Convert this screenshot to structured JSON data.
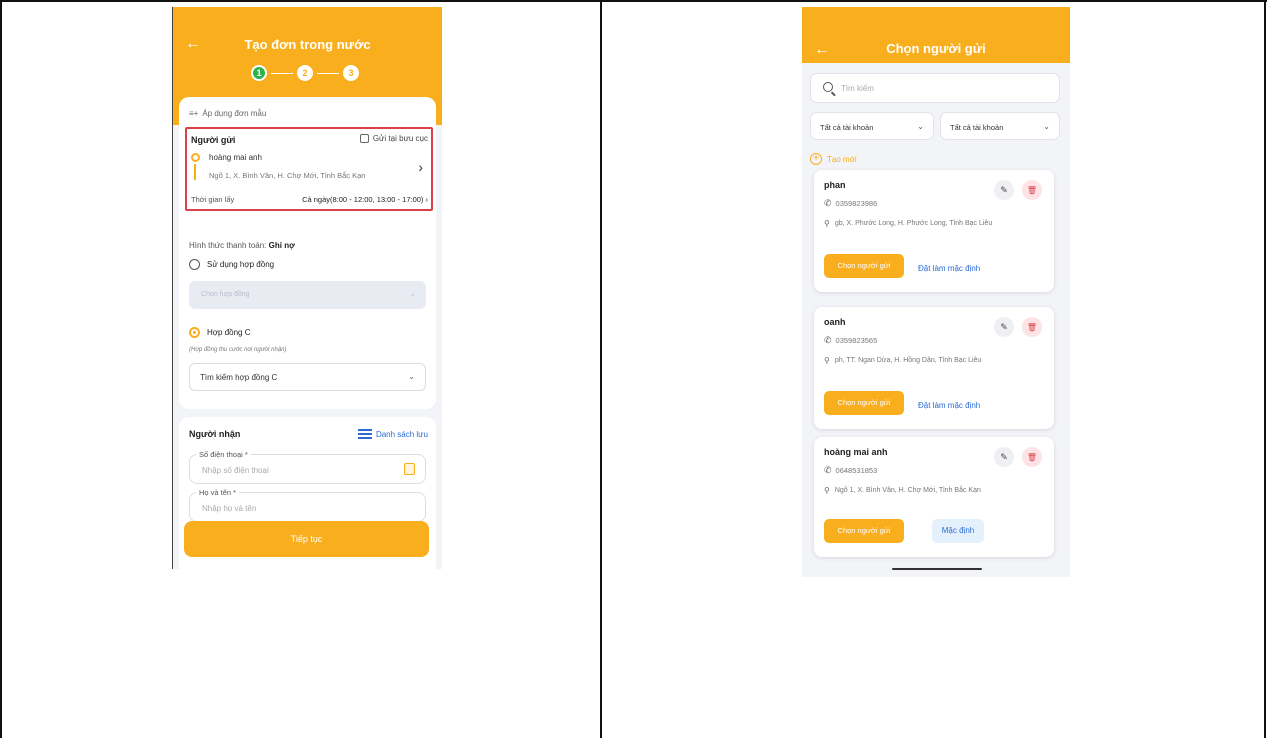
{
  "left_screen": {
    "header": {
      "title": "Tạo đơn trong nước",
      "steps": [
        "1",
        "2",
        "3"
      ]
    },
    "apply_template": "Áp dụng đơn mẫu",
    "sender": {
      "label": "Người gửi",
      "post_office_checkbox": "Gửi tại bưu cục",
      "name": "hoàng mai anh",
      "address": "Ngõ 1, X. Bình Văn, H. Chợ Mới, Tỉnh Bắc Kạn",
      "pickup_label": "Thời gian lấy",
      "pickup_value": "Cả ngày(8:00 - 12:00, 13:00 - 17:00) ›"
    },
    "payment": {
      "label": "Hình thức thanh toán:",
      "value": "Ghi nợ"
    },
    "option_contract": "Sử dụng hợp đồng",
    "contract_select_placeholder": "Chọn hợp đồng",
    "option_contract_c": "Hợp đồng C",
    "contract_c_note": "(Hợp đồng thu cước nơi người nhận)",
    "search_contract_c": "Tìm kiếm hợp đồng C",
    "receiver": {
      "label": "Người nhận",
      "saved_list": "Danh sách lưu",
      "phone_label": "Số điện thoại *",
      "phone_placeholder": "Nhập số điện thoại",
      "name_label": "Họ và tên *",
      "name_placeholder": "Nhập họ và tên"
    },
    "continue_button": "Tiếp tục"
  },
  "right_screen": {
    "header": {
      "title": "Chọn người gửi"
    },
    "search_placeholder": "Tìm kiếm",
    "filter1": "Tất cả tài khoản",
    "filter2": "Tất cả tài khoản",
    "create_new": "Tạo mới",
    "choose_label": "Chọn người gửi",
    "set_default_label": "Đặt làm mặc định",
    "default_badge": "Mặc định",
    "senders": [
      {
        "name": "phan",
        "phone": "0359823986",
        "address": "gb, X. Phước Long, H. Phước Long, Tỉnh Bạc Liêu"
      },
      {
        "name": "oanh",
        "phone": "0359823565",
        "address": "ph, TT. Ngan Dừa, H. Hồng Dân, Tỉnh Bạc Liêu"
      },
      {
        "name": "hoàng mai anh",
        "phone": "0648531853",
        "address": "Ngõ 1, X. Bình Văn, H. Chợ Mới, Tỉnh Bắc Kạn"
      }
    ]
  }
}
